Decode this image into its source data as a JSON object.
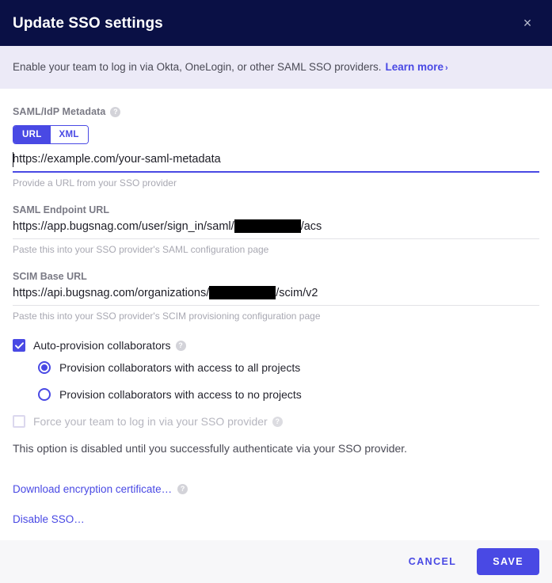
{
  "header": {
    "title": "Update SSO settings",
    "close_label": "×"
  },
  "banner": {
    "text": "Enable your team to log in via Okta, OneLogin, or other SAML SSO providers.",
    "link_label": "Learn more",
    "chevron": "›"
  },
  "metadata": {
    "label": "SAML/IdP Metadata",
    "help": "?",
    "toggle": {
      "options": [
        "URL",
        "XML"
      ],
      "selected": "URL"
    },
    "input_value": "https://example.com/your-saml-metadata",
    "input_placeholder": "https://example.com/your-saml-metadata",
    "hint": "Provide a URL from your SSO provider"
  },
  "saml_endpoint": {
    "label": "SAML Endpoint URL",
    "value_prefix": "https://app.bugsnag.com/user/sign_in/saml/",
    "value_suffix": "/acs",
    "hint": "Paste this into your SSO provider's SAML configuration page"
  },
  "scim_base": {
    "label": "SCIM Base URL",
    "value_prefix": "https://api.bugsnag.com/organizations/",
    "value_suffix": "/scim/v2",
    "hint": "Paste this into your SSO provider's SCIM provisioning configuration page"
  },
  "auto_provision": {
    "label": "Auto-provision collaborators",
    "help": "?",
    "checked": true,
    "options": [
      {
        "label": "Provision collaborators with access to all projects",
        "selected": true
      },
      {
        "label": "Provision collaborators with access to no projects",
        "selected": false
      }
    ]
  },
  "force_login": {
    "label": "Force your team to log in via your SSO provider",
    "help": "?",
    "checked": false,
    "disabled": true,
    "note": "This option is disabled until you successfully authenticate via your SSO provider."
  },
  "links": {
    "download_cert": "Download encryption certificate…",
    "download_cert_help": "?",
    "disable_sso": "Disable SSO…"
  },
  "footer": {
    "cancel_label": "CANCEL",
    "save_label": "SAVE"
  },
  "colors": {
    "header_bg": "#0a1045",
    "banner_bg": "#eceaf7",
    "accent": "#4949e4",
    "footer_bg": "#f7f7f9",
    "text": "#24242e",
    "muted": "#a8a8b2"
  }
}
